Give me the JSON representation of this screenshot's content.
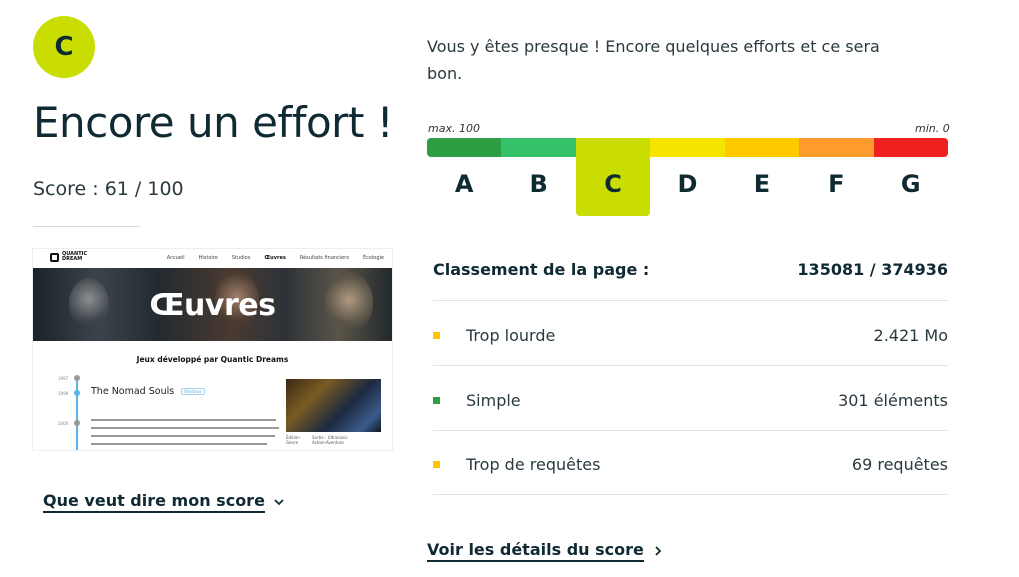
{
  "grade": {
    "letter": "C",
    "headline": "Encore un effort !",
    "score_label": "Score : 61 / 100",
    "badge_color": "#c9dd02"
  },
  "message": "Vous y êtes presque ! Encore quelques efforts et ce sera bon.",
  "scale": {
    "max_label": "max. 100",
    "min_label": "min. 0",
    "current_index": 2,
    "segments": [
      {
        "letter": "A",
        "color": "#2e9e44"
      },
      {
        "letter": "B",
        "color": "#35c06a"
      },
      {
        "letter": "C",
        "color": "#c9dd02"
      },
      {
        "letter": "D",
        "color": "#f5e400"
      },
      {
        "letter": "E",
        "color": "#ffc900"
      },
      {
        "letter": "F",
        "color": "#ff9a2e"
      },
      {
        "letter": "G",
        "color": "#ee2020"
      }
    ]
  },
  "ranking": {
    "label": "Classement de la page :",
    "value": "135081 / 374936"
  },
  "metrics": [
    {
      "label": "Trop lourde",
      "value": "2.421 Mo",
      "color": "#ffc900"
    },
    {
      "label": "Simple",
      "value": "301 éléments",
      "color": "#2e9e44"
    },
    {
      "label": "Trop de requêtes",
      "value": "69 requêtes",
      "color": "#ffc900"
    }
  ],
  "links": {
    "score_meaning": "Que veut dire mon score",
    "details": "Voir les détails du score"
  },
  "thumbnail": {
    "logo_line1": "QUANTIC",
    "logo_line2": "DREAM",
    "nav": [
      "Accueil",
      "Histoire",
      "Studios",
      "Œuvres",
      "Résultats financiers",
      "Écologie"
    ],
    "nav_active": 3,
    "banner_title": "Œuvres",
    "subtitle": "Jeux développé par Quantic Dreams",
    "years": [
      "1997",
      "1999",
      "2000"
    ],
    "game_title": "The Nomad Souls",
    "game_tag": "Windows",
    "meta_left": "Édition\nGenre",
    "meta_right": "Sortie : Ultrasonic\nAction-Aventure"
  }
}
